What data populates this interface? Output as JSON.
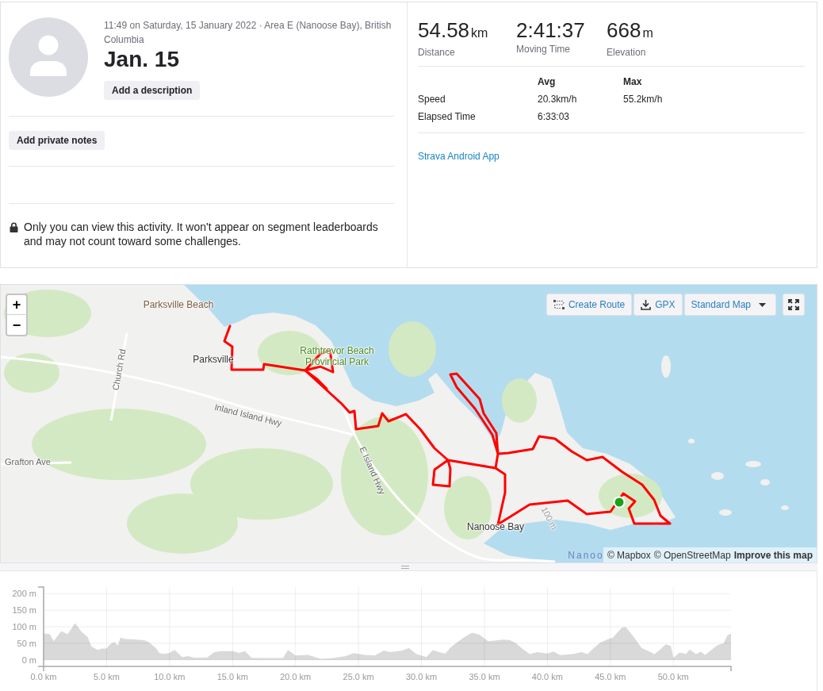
{
  "activity": {
    "meta": "11:49 on Saturday, 15 January 2022 · Area E (Nanoose Bay), British Columbia",
    "title": "Jan. 15",
    "description_button": "Add a description",
    "notes_button": "Add private notes",
    "privacy_notice": "Only you can view this activity. It won't appear on segment leaderboards and may not count toward some challenges."
  },
  "stats": [
    {
      "value": "54.58",
      "unit": "km",
      "label": "Distance"
    },
    {
      "value": "2:41:37",
      "label": "Moving Time"
    },
    {
      "value": "668",
      "unit": "m",
      "label": "Elevation"
    }
  ],
  "details": {
    "columns": [
      "Avg",
      "Max"
    ],
    "rows": [
      {
        "label": "Speed",
        "values": [
          "20.3km/h",
          "55.2km/h"
        ]
      },
      {
        "label": "Elapsed Time",
        "values": [
          "6:33:03"
        ]
      }
    ]
  },
  "device_link": "Strava Android App",
  "map": {
    "zoom_controls": [
      "+",
      "−"
    ],
    "toolbar": [
      {
        "kind": "create_route",
        "label": "Create Route"
      },
      {
        "kind": "download",
        "label": "GPX"
      },
      {
        "kind": "map_style",
        "label": "Standard Map"
      },
      {
        "kind": "fullscreen"
      }
    ],
    "labels": [
      {
        "text": "Parksville Beach",
        "kind": "beach"
      },
      {
        "text": "Parksville",
        "kind": "place"
      },
      {
        "text": "Rathtrevor Beach Provincial Park",
        "kind": "park"
      },
      {
        "text": "Church Rd",
        "kind": "road"
      },
      {
        "text": "Inland Island Hwy",
        "kind": "road"
      },
      {
        "text": "Grafton Ave",
        "kind": "road"
      },
      {
        "text": "E Island Hwy",
        "kind": "road"
      },
      {
        "text": "Nanoose Bay",
        "kind": "place"
      },
      {
        "text": "100 m",
        "kind": "contour"
      },
      {
        "text": "Nanoo",
        "kind": "water"
      }
    ],
    "attribution": {
      "credits": [
        "© Mapbox",
        "© OpenStreetMap"
      ],
      "feedback_link": "Improve this map"
    }
  },
  "elevation": {
    "chart_data": {
      "type": "area",
      "grid": true,
      "x": [
        0,
        0.5,
        0.8,
        1.4,
        1.9,
        2.5,
        3.0,
        3.5,
        3.8,
        4.3,
        4.6,
        5.0,
        5.3,
        5.6,
        5.9,
        6.1,
        6.5,
        7,
        8,
        8.4,
        8.9,
        9.2,
        9.6,
        10,
        10.4,
        11,
        11.5,
        12,
        13,
        13.5,
        14,
        15,
        15.5,
        16,
        16.5,
        17.5,
        19,
        19.4,
        20,
        21,
        22,
        23,
        24,
        24.6,
        25.5,
        26.3,
        27,
        27.5,
        28.5,
        29,
        29.6,
        30.4,
        30.9,
        31.4,
        31.9,
        32.3,
        32.8,
        33.4,
        34,
        34.6,
        35.3,
        35.8,
        36.5,
        37,
        37.5,
        38,
        38.6,
        39.2,
        40,
        40.5,
        41,
        42,
        42.7,
        43.2,
        43.6,
        44.2,
        44.8,
        45.2,
        45.9,
        46.2,
        46.8,
        47.5,
        48.1,
        48.5,
        48.9,
        49.4,
        49.8,
        50,
        50.5,
        51,
        51.3,
        51.8,
        52.2,
        52.5,
        53,
        53.5,
        54,
        54.3,
        54.58
      ],
      "series": [
        {
          "color": "#d9d9d9",
          "values": [
            80,
            77,
            56,
            87,
            77,
            111,
            85,
            69,
            40,
            30,
            34,
            34,
            48,
            54,
            43,
            67,
            63,
            62,
            59,
            52,
            36,
            20,
            18,
            21,
            30,
            8,
            11,
            6,
            7,
            22,
            26,
            26,
            21,
            26,
            6,
            5,
            5,
            30,
            13,
            15,
            3,
            5,
            11,
            20,
            15,
            13,
            28,
            23,
            28,
            36,
            17,
            8,
            29,
            23,
            19,
            37,
            52,
            68,
            82,
            76,
            56,
            58,
            61,
            60,
            50,
            34,
            17,
            23,
            19,
            25,
            14,
            17,
            23,
            17,
            33,
            52,
            62,
            67,
            97,
            100,
            72,
            35,
            25,
            17,
            29,
            47,
            42,
            6,
            22,
            17,
            31,
            17,
            25,
            14,
            29,
            44,
            50,
            75,
            79
          ]
        }
      ],
      "xlim": [
        0,
        54.58
      ],
      "ylim": [
        -20,
        220
      ],
      "xticks": [
        {
          "value": 0,
          "label": "0.0 km"
        },
        {
          "value": 5,
          "label": "5.0 km"
        },
        {
          "value": 10,
          "label": "10.0 km"
        },
        {
          "value": 15,
          "label": "15.0 km"
        },
        {
          "value": 20,
          "label": "20.0 km"
        },
        {
          "value": 25,
          "label": "25.0 km"
        },
        {
          "value": 30,
          "label": "30.0 km"
        },
        {
          "value": 35,
          "label": "35.0 km"
        },
        {
          "value": 40,
          "label": "40.0 km"
        },
        {
          "value": 45,
          "label": "45.0 km"
        },
        {
          "value": 50,
          "label": "50.0 km"
        }
      ],
      "yticks": [
        {
          "value": 0,
          "label": "0 m"
        },
        {
          "value": 50,
          "label": "50 m"
        },
        {
          "value": 100,
          "label": "100 m"
        },
        {
          "value": 150,
          "label": "150 m"
        },
        {
          "value": 200,
          "label": "200 m"
        }
      ]
    }
  }
}
